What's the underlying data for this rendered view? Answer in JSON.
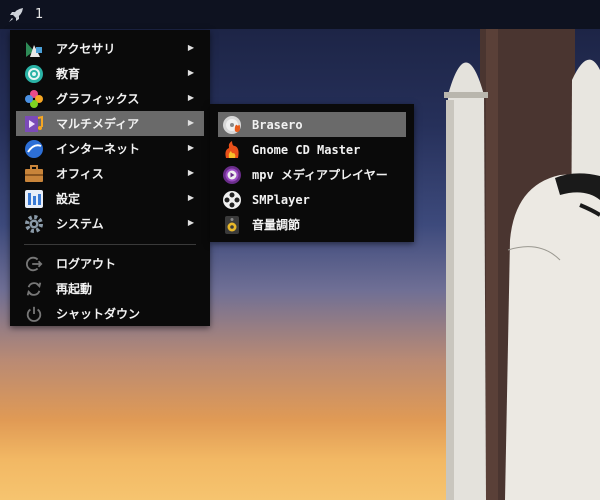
{
  "panel": {
    "workspace": "1"
  },
  "main_menu": {
    "items": [
      {
        "label": "アクセサリ",
        "icon": "accessories-icon"
      },
      {
        "label": "教育",
        "icon": "education-icon"
      },
      {
        "label": "グラフィックス",
        "icon": "graphics-icon"
      },
      {
        "label": "マルチメディア",
        "icon": "multimedia-icon"
      },
      {
        "label": "インターネット",
        "icon": "internet-icon"
      },
      {
        "label": "オフィス",
        "icon": "office-icon"
      },
      {
        "label": "設定",
        "icon": "settings-icon"
      },
      {
        "label": "システム",
        "icon": "system-icon"
      }
    ],
    "actions": [
      {
        "label": "ログアウト",
        "icon": "logout-icon"
      },
      {
        "label": "再起動",
        "icon": "restart-icon"
      },
      {
        "label": "シャットダウン",
        "icon": "power-icon"
      }
    ],
    "arrow": "▶"
  },
  "sub_menu": {
    "items": [
      {
        "label": "Brasero",
        "icon": "brasero-icon"
      },
      {
        "label": "Gnome CD Master",
        "icon": "gnome-cd-master-icon"
      },
      {
        "label": "mpv メディアプレイヤー",
        "icon": "mpv-icon"
      },
      {
        "label": "SMPlayer",
        "icon": "smplayer-icon"
      },
      {
        "label": "音量調節",
        "icon": "volume-control-icon"
      }
    ]
  },
  "colors": {
    "menu_bg": "#0a0a0a",
    "highlight": "#6a6a6a",
    "panel_bg": "#0e1220"
  }
}
